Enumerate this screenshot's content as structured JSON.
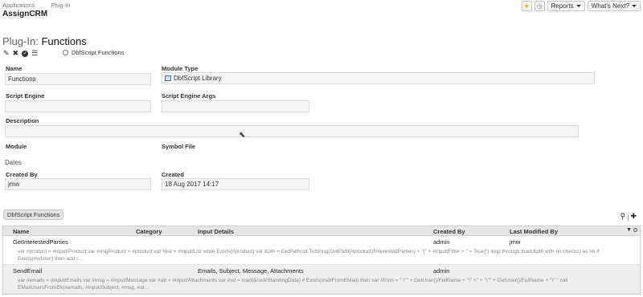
{
  "topnav": {
    "applications": "Applications",
    "plugin": "Plug-In",
    "app_title": "AssignCRM"
  },
  "header_buttons": {
    "reports": "Reports",
    "whats_next": "What's Next?"
  },
  "page": {
    "prefix": "Plug-In:",
    "title": "Functions",
    "script_link": "DbfScript Functions"
  },
  "form": {
    "name_label": "Name",
    "name_value": "Functions",
    "module_type_label": "Module Type",
    "module_type_value": "DbfScript Library",
    "script_engine_label": "Script Engine",
    "script_engine_value": "",
    "script_engine_args_label": "Script Engine Args",
    "script_engine_args_value": "",
    "description_label": "Description",
    "description_value": "",
    "module_label": "Module",
    "symbol_file_label": "Symbol File",
    "dates_label": "Dates",
    "created_by_label": "Created By",
    "created_by_value": "jmw",
    "created_label": "Created",
    "created_value": "18 Aug 2017 14:17"
  },
  "table_tab": "DbfScript Functions",
  "table": {
    "headers": [
      "Name",
      "Category",
      "Input Details",
      "Created By",
      "Last Modified By"
    ],
    "rows": [
      {
        "name": "GetInterestedParties",
        "category": "",
        "input_details": "",
        "created_by": "admin",
        "last_modified_by": "jmw",
        "code": "var #product = #input/Product var #origProduct = #product var #list = #input/List while Exists(#product) var &pth = GetPath(str.ToString(GetPath(#product)/InterestedParties) + \"[\" + #input/Filter + \" = True]\") loop through load(&pth with no checks) as #e if Exists(#e/User) then add i..."
      },
      {
        "name": "SendEmail",
        "category": "",
        "input_details": "Emails, Subject, Message, Attachments",
        "created_by": "admin",
        "last_modified_by": "",
        "code": "var #emails = #input/Emails var #msg = #input/Message var #att = #input/Attachments var #sd = load(&root/StandingData) if Exists(#sd/FromEMail) then var #from = \" \\\"\" + GetUser()/FullName + \"\\\" <\" + \"\\\"\" + GetUser()/FullName + \"\\\" \" call EMailUsersFromEx(#emails, #input/Subject, #msg, #at..."
      }
    ]
  }
}
